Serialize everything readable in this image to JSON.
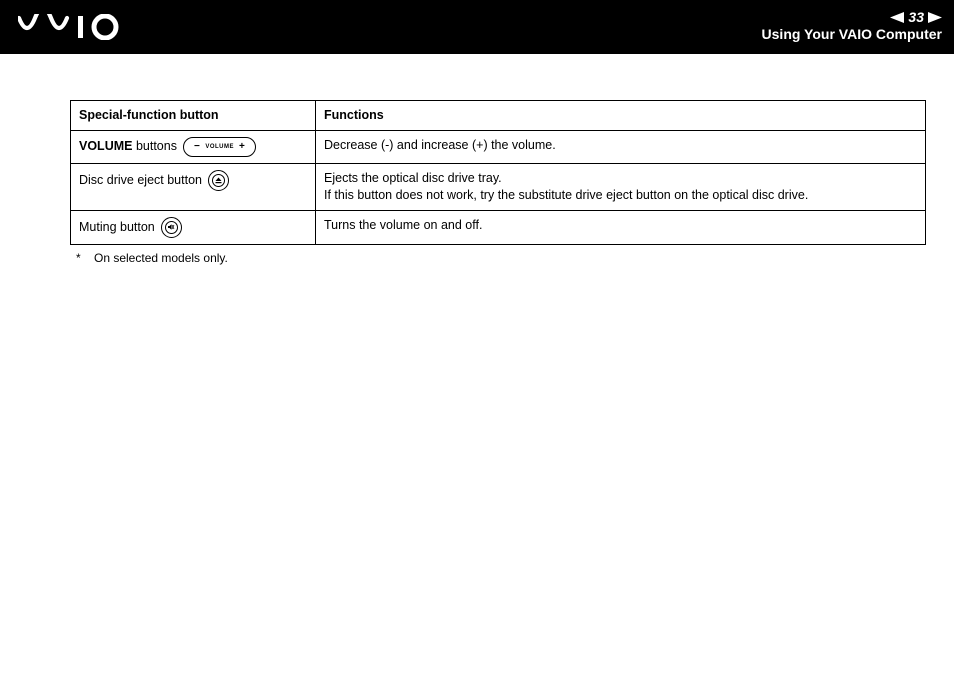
{
  "header": {
    "page_number": "33",
    "section": "Using Your VAIO Computer"
  },
  "table": {
    "col1_header": "Special-function button",
    "col2_header": "Functions",
    "rows": [
      {
        "label_bold": "VOLUME",
        "label_rest": " buttons ",
        "icon": "volume-buttons",
        "desc_line1": "Decrease (-) and increase (+) the volume.",
        "desc_line2": ""
      },
      {
        "label_bold": "",
        "label_rest": "Disc drive eject button ",
        "icon": "eject",
        "desc_line1": "Ejects the optical disc drive tray.",
        "desc_line2": "If this button does not work, try the substitute drive eject button on the optical disc drive."
      },
      {
        "label_bold": "",
        "label_rest": "Muting button ",
        "icon": "mute",
        "desc_line1": "Turns the volume on and off.",
        "desc_line2": ""
      }
    ]
  },
  "footnote": {
    "mark": "*",
    "text": "On selected models only."
  },
  "icon_texts": {
    "volume_word": "VOLUME",
    "minus": "−",
    "plus": "+"
  }
}
